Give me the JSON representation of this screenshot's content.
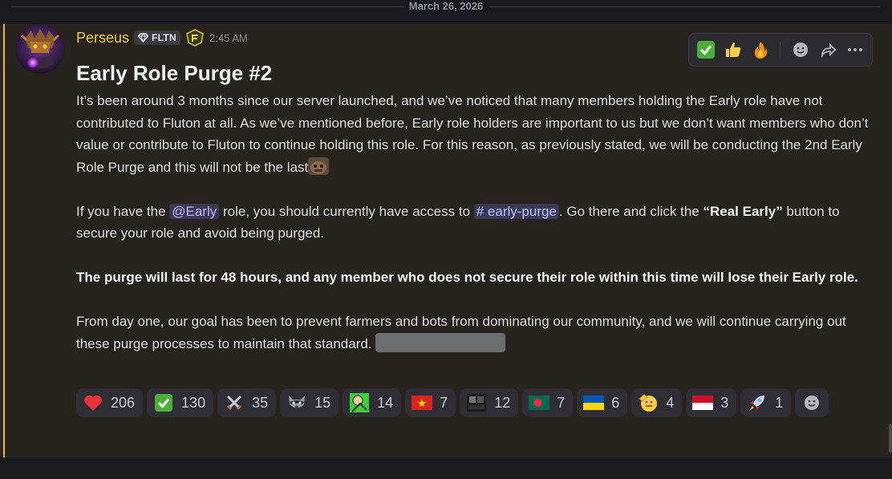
{
  "date_divider": "March 26, 2026",
  "message": {
    "username": "Perseus",
    "tag": "FLTN",
    "timestamp": "2:45 AM",
    "title": "Early Role Purge #2",
    "para1": "It’s been around 3 months since our server launched, and we’ve noticed that many members holding the Early role have not contributed to Fluton at all. As we’ve mentioned before, Early role holders are important to us but we don’t want members who don’t value or contribute to Fluton to continue holding this role. For this reason, as previously stated, we will be conducting the 2nd Early Role Purge and this will not be the last",
    "para2_a": "If you have the ",
    "mention": "@Early",
    "para2_b": " role, you should currently have access to ",
    "channel": "# early-purge",
    "para2_c": ". Go there and click the ",
    "para2_bold": "“Real Early”",
    "para2_d": " button to secure your role and avoid being purged.",
    "para3_bold": "The purge will last for 48 hours, and any member who does not secure their role within this time will lose their Early role.",
    "para4": "From day one, our goal has been to prevent farmers and bots from dominating our community, and we will continue carrying out these purge processes to maintain that standard."
  },
  "reactions": [
    {
      "emoji": "heart-icon",
      "count": "206"
    },
    {
      "emoji": "check-icon",
      "count": "130"
    },
    {
      "emoji": "swords-icon",
      "count": "35"
    },
    {
      "emoji": "raccoon-icon",
      "count": "15"
    },
    {
      "emoji": "green-emoji-icon",
      "count": "14"
    },
    {
      "emoji": "vietnam-flag-icon",
      "count": "7"
    },
    {
      "emoji": "cinema-icon",
      "count": "12"
    },
    {
      "emoji": "bangladesh-flag-icon",
      "count": "7"
    },
    {
      "emoji": "ukraine-flag-icon",
      "count": "6"
    },
    {
      "emoji": "saluting-face-icon",
      "count": "4"
    },
    {
      "emoji": "indonesia-flag-icon",
      "count": "3"
    },
    {
      "emoji": "rocket-icon",
      "count": "1"
    }
  ],
  "toolbar": {
    "quick_reactions": [
      "check-icon",
      "thumbs-up-icon",
      "fire-icon"
    ]
  },
  "colors": {
    "username": "#e8d23d",
    "mention_bar": "#f0b232",
    "message_bg": "#27241f"
  }
}
